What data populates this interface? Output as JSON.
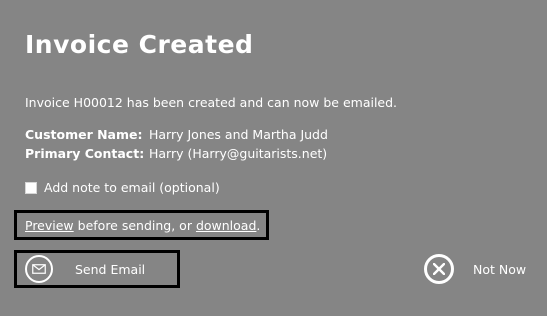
{
  "dialog": {
    "title": "Invoice Created",
    "message": "Invoice H00012 has been created and can now be emailed."
  },
  "details": {
    "customer_label": "Customer Name:",
    "customer_value": "Harry Jones and Martha Judd",
    "contact_label": "Primary Contact:",
    "contact_value": "Harry (Harry@guitarists.net)"
  },
  "note": {
    "checked": false,
    "label": "Add note to email (optional)"
  },
  "preview": {
    "preview_link": "Preview",
    "middle_text": " before sending, or ",
    "download_link": "download",
    "end_text": "."
  },
  "actions": {
    "send_label": "Send Email",
    "send_icon": "envelope-icon",
    "notnow_label": "Not Now",
    "notnow_icon": "close-icon"
  },
  "colors": {
    "background": "#858585",
    "text": "#ffffff",
    "highlight_border": "#000000"
  }
}
